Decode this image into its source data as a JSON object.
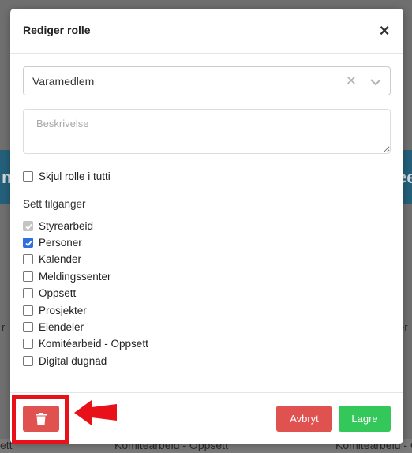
{
  "modal": {
    "title": "Rediger rolle",
    "close_icon": "close-icon"
  },
  "role_select": {
    "value": "Varamedlem",
    "clear_icon": "clear-x-icon",
    "dropdown_icon": "chevron-down-icon"
  },
  "description": {
    "placeholder": "Beskrivelse",
    "value": ""
  },
  "hide_role": {
    "label": "Skjul rolle i tutti",
    "checked": false
  },
  "permissions": {
    "section_label": "Sett tilganger",
    "items": [
      {
        "label": "Styrearbeid",
        "checked": true,
        "disabled": true
      },
      {
        "label": "Personer",
        "checked": true,
        "disabled": false
      },
      {
        "label": "Kalender",
        "checked": false,
        "disabled": false
      },
      {
        "label": "Meldingssenter",
        "checked": false,
        "disabled": false
      },
      {
        "label": "Oppsett",
        "checked": false,
        "disabled": false
      },
      {
        "label": "Prosjekter",
        "checked": false,
        "disabled": false
      },
      {
        "label": "Eiendeler",
        "checked": false,
        "disabled": false
      },
      {
        "label": "Komitéarbeid - Oppsett",
        "checked": false,
        "disabled": false
      },
      {
        "label": "Digital dugnad",
        "checked": false,
        "disabled": false
      }
    ]
  },
  "footer": {
    "delete_icon": "trash-icon",
    "cancel_label": "Avbryt",
    "save_label": "Lagre"
  },
  "background": {
    "band_left_char": "m",
    "band_right_chars": "ee",
    "bottom_left_text": "ett",
    "bottom_mid_text": "Komitéarbeid - Oppsett",
    "bottom_right_text": "Komitéarbeid - O",
    "side_left_char": "r",
    "side_right_char": "er"
  },
  "colors": {
    "primary_check": "#2f6fe0",
    "danger": "#e05250",
    "success": "#34c759",
    "annotation": "#e8111a"
  }
}
